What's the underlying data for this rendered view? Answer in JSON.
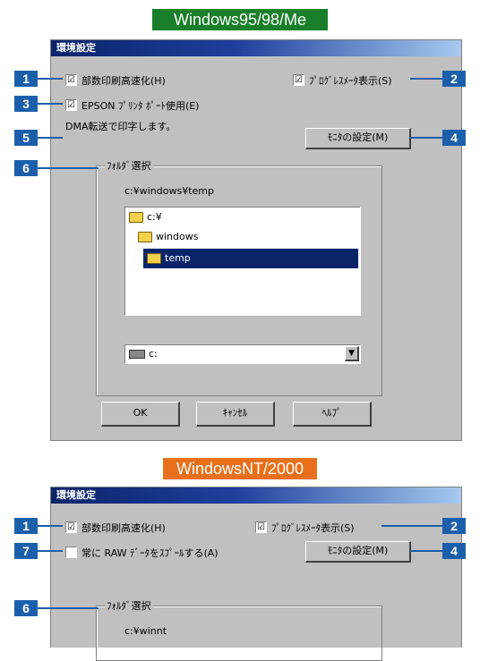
{
  "banners": {
    "top": "Windows95/98/Me",
    "bottom": "WindowsNT/2000"
  },
  "colors": {
    "banner_top": "#1a7f2a",
    "banner_bottom": "#e8701a",
    "badge": "#1b5faa"
  },
  "dialog1": {
    "title": "環境設定",
    "checkboxes": [
      {
        "label": "部数印刷高速化(H)",
        "checked": "☑"
      },
      {
        "label": "ﾌﾟﾛｸﾞﾚｽﾒｰﾀ表示(S)",
        "checked": "☑"
      },
      {
        "label": "EPSON ﾌﾟﾘﾝﾀ ﾎﾟｰﾄ使用(E)",
        "checked": "☑"
      }
    ],
    "dma_text": "DMA転送で印字します。",
    "monitor_button": "ﾓﾆﾀの設定(M)",
    "folder_group_title": "ﾌｫﾙﾀﾞ選択",
    "current_path": "c:¥windows¥temp",
    "folder_tree": [
      "c:¥",
      "windows",
      "temp"
    ],
    "drive": "c:",
    "buttons": {
      "ok": "OK",
      "cancel": "ｷｬﾝｾﾙ",
      "help": "ﾍﾙﾌﾟ"
    }
  },
  "dialog2": {
    "title": "環境設定",
    "checkboxes": [
      {
        "label": "部数印刷高速化(H)",
        "checked": "☑"
      },
      {
        "label": "ﾌﾟﾛｸﾞﾚｽﾒｰﾀ表示(S)",
        "checked": "☑"
      },
      {
        "label": "常に RAW ﾃﾞｰﾀをｽﾌﾟｰﾙする(A)",
        "checked": ""
      }
    ],
    "monitor_button": "ﾓﾆﾀの設定(M)",
    "folder_group_title": "ﾌｫﾙﾀﾞ選択",
    "current_path": "c:¥winnt"
  },
  "callouts": {
    "d1": [
      "1",
      "2",
      "3",
      "4",
      "5",
      "6"
    ],
    "d2": [
      "1",
      "2",
      "7",
      "4",
      "6"
    ]
  }
}
